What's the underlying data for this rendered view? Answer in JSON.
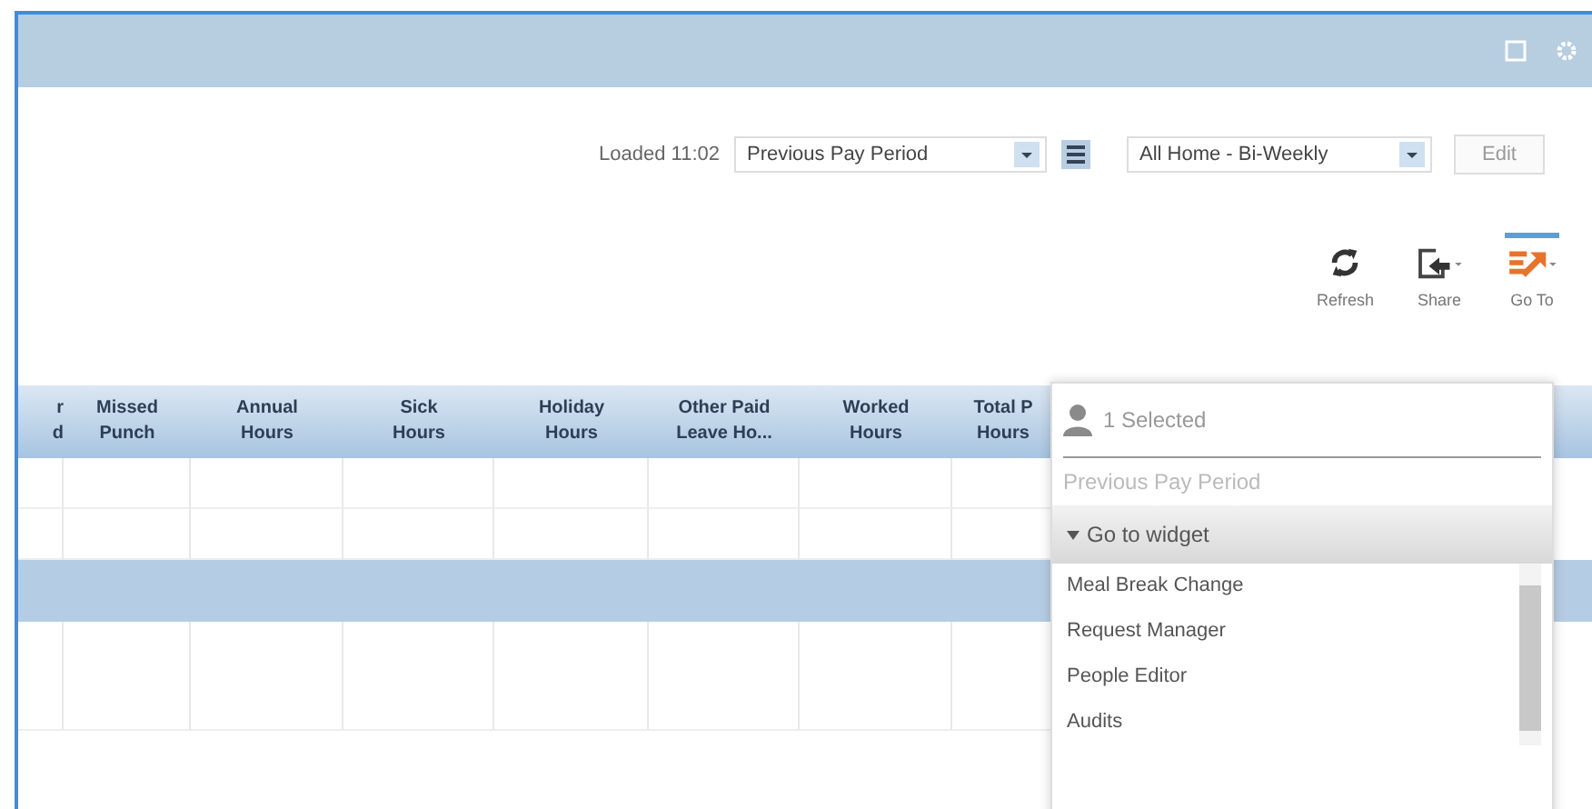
{
  "toolbar": {
    "loaded": "Loaded 11:02",
    "period_select": {
      "value": "Previous Pay Period"
    },
    "schedule_select": {
      "value": "All Home - Bi-Weekly"
    },
    "edit_button": {
      "label": "Edit",
      "disabled": true
    }
  },
  "actions": [
    {
      "kind": "refresh",
      "label": "Refresh",
      "selected": false
    },
    {
      "kind": "share",
      "label": "Share",
      "selected": false
    },
    {
      "kind": "goto",
      "label": "Go To",
      "selected": true
    }
  ],
  "table": {
    "columns": [
      {
        "lines": [
          "r",
          "d"
        ]
      },
      {
        "lines": [
          "Missed",
          "Punch"
        ]
      },
      {
        "lines": [
          "Annual",
          "Hours"
        ]
      },
      {
        "lines": [
          "Sick",
          "Hours"
        ]
      },
      {
        "lines": [
          "Holiday",
          "Hours"
        ]
      },
      {
        "lines": [
          "Other Paid",
          "Leave Ho..."
        ]
      },
      {
        "lines": [
          "Worked",
          "Hours"
        ]
      },
      {
        "lines": [
          "Total P",
          "Hours"
        ]
      }
    ],
    "rows": [
      {
        "kind": "data"
      },
      {
        "kind": "data"
      },
      {
        "kind": "group"
      },
      {
        "kind": "data"
      }
    ]
  },
  "goto_menu": {
    "selection": "1 Selected",
    "period": "Previous Pay Period",
    "section": "Go to widget",
    "items": [
      {
        "label": "Meal Break Change"
      },
      {
        "label": "Request Manager"
      },
      {
        "label": "People Editor"
      },
      {
        "label": "Audits"
      }
    ]
  }
}
